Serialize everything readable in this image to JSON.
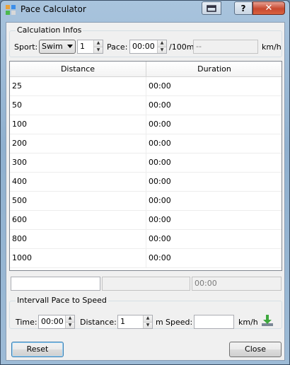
{
  "window": {
    "title": "Pace Calculator"
  },
  "calc": {
    "group_title": "Calculation Infos",
    "sport_label": "Sport:",
    "sport_value": "Swim",
    "count_value": "1",
    "pace_label": "Pace:",
    "pace_value": "00:00",
    "pace_unit": "/100m",
    "speed_value": "--",
    "speed_unit": "km/h"
  },
  "table": {
    "headers": [
      "Distance",
      "Duration"
    ],
    "rows": [
      [
        "25",
        "00:00"
      ],
      [
        "50",
        "00:00"
      ],
      [
        "100",
        "00:00"
      ],
      [
        "200",
        "00:00"
      ],
      [
        "300",
        "00:00"
      ],
      [
        "400",
        "00:00"
      ],
      [
        "500",
        "00:00"
      ],
      [
        "600",
        "00:00"
      ],
      [
        "800",
        "00:00"
      ],
      [
        "1000",
        "00:00"
      ]
    ]
  },
  "custom_row": {
    "distance": "",
    "pace": "",
    "duration": "00:00"
  },
  "intervall": {
    "group_title": "Intervall Pace to Speed",
    "time_label": "Time:",
    "time_value": "00:00",
    "distance_label": "Distance:",
    "distance_value": "1",
    "distance_unit": "m",
    "speed_label": "Speed:",
    "speed_value": "",
    "speed_unit": "km/h"
  },
  "buttons": {
    "reset": "Reset",
    "close": "Close"
  },
  "icons": {
    "app": "app-icon",
    "restore": "restore-icon",
    "help": "help-icon",
    "close": "close-icon",
    "apply": "download-arrow-icon"
  }
}
